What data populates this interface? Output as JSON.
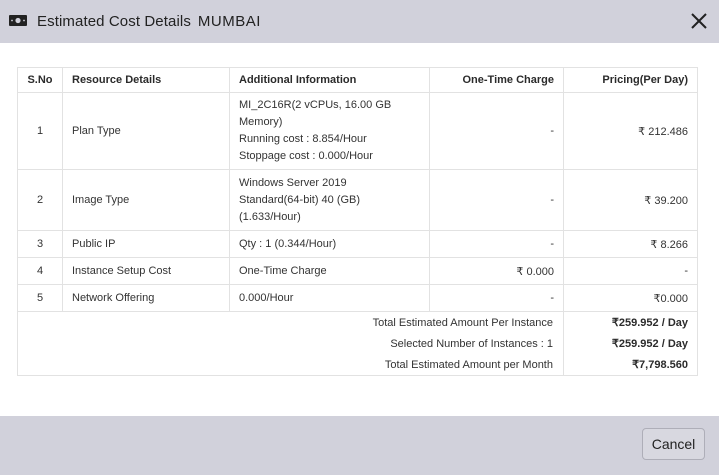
{
  "dialog": {
    "title": "Estimated Cost Details",
    "location": "MUMBAI",
    "cancel_label": "Cancel"
  },
  "table": {
    "headers": [
      "S.No",
      "Resource Details",
      "Additional Information",
      "One-Time Charge",
      "Pricing(Per Day)"
    ],
    "rows": [
      {
        "sno": "1",
        "resource": "Plan Type",
        "info": [
          "MI_2C16R(2 vCPUs, 16.00 GB",
          "Memory)",
          "Running cost : 8.854/Hour",
          "Stoppage cost : 0.000/Hour"
        ],
        "one_time": "-",
        "pricing": "₹ 212.486"
      },
      {
        "sno": "2",
        "resource": "Image Type",
        "info": [
          "Windows Server 2019",
          "Standard(64-bit) 40 (GB)",
          "(1.633/Hour)"
        ],
        "one_time": "-",
        "pricing": "₹ 39.200"
      },
      {
        "sno": "3",
        "resource": "Public IP",
        "info": [
          "Qty : 1 (0.344/Hour)"
        ],
        "one_time": "-",
        "pricing": "₹ 8.266"
      },
      {
        "sno": "4",
        "resource": "Instance Setup Cost",
        "info": [
          "One-Time Charge"
        ],
        "one_time": "₹ 0.000",
        "pricing": "-"
      },
      {
        "sno": "5",
        "resource": "Network Offering",
        "info": [
          "0.000/Hour"
        ],
        "one_time": "-",
        "pricing": "₹0.000"
      }
    ],
    "summary": [
      {
        "label": "Total Estimated Amount Per Instance",
        "value": "₹259.952 / Day"
      },
      {
        "label": "Selected Number of Instances : 1",
        "value": "₹259.952 / Day"
      },
      {
        "label": "Total Estimated Amount per Month",
        "value": "₹7,798.560"
      }
    ]
  },
  "icons": {
    "header": "money-icon",
    "close": "close-icon"
  },
  "colors": {
    "header_bg": "#d1d1db",
    "body_bg": "#ffffff",
    "border": "#e2e2e2"
  }
}
